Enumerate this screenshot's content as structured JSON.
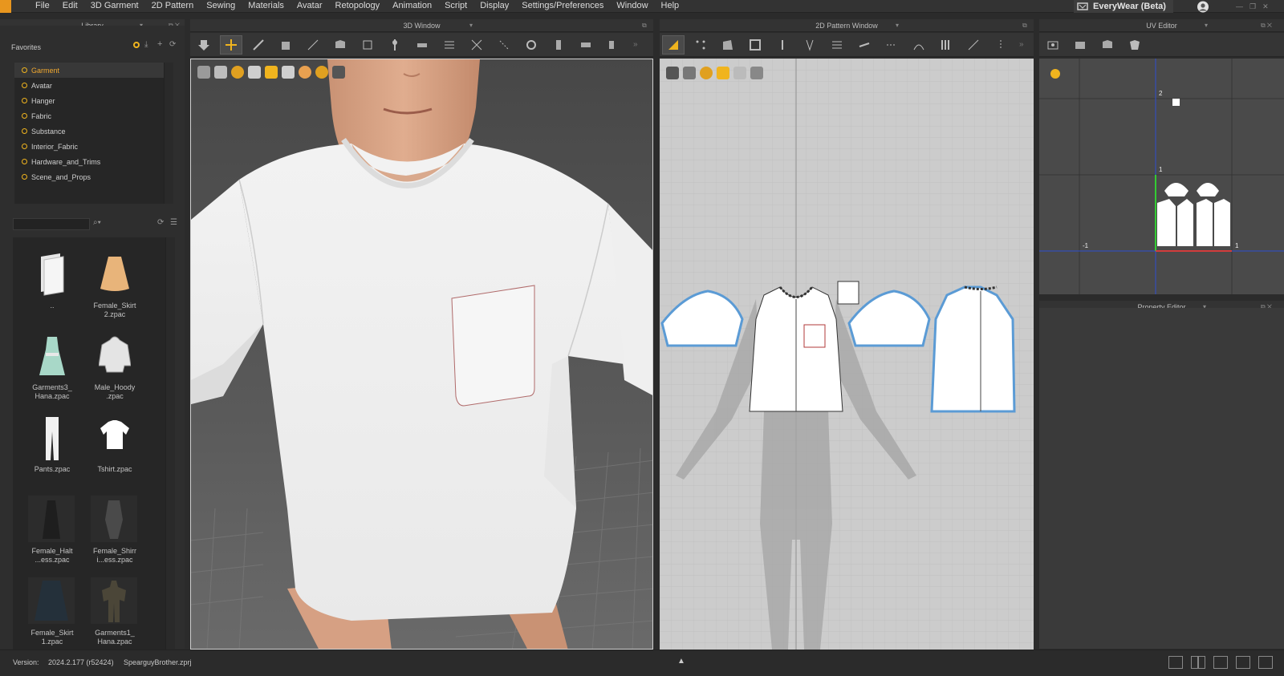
{
  "menubar": {
    "items": [
      "File",
      "Edit",
      "3D Garment",
      "2D Pattern",
      "Sewing",
      "Materials",
      "Avatar",
      "Retopology",
      "Animation",
      "Script",
      "Display",
      "Settings/Preferences",
      "Window",
      "Help"
    ],
    "brand_label": "EveryWear (Beta)"
  },
  "panels": {
    "library_title": "Library",
    "window3d_title": "3D Window",
    "window2d_title": "2D Pattern Window",
    "uv_title": "UV Editor",
    "property_title": "Property Editor"
  },
  "library": {
    "favorites_label": "Favorites",
    "folders": [
      "Garment",
      "Avatar",
      "Hanger",
      "Fabric",
      "Substance",
      "Interior_Fabric",
      "Hardware_and_Trims",
      "Scene_and_Props"
    ],
    "selected_folder": "Garment",
    "items": [
      {
        "caption": "..",
        "icon": "folder-up-icon"
      },
      {
        "caption": "Female_Skirt 2.zpac",
        "icon": "skirt-icon"
      },
      {
        "caption": "Garments3_ Hana.zpac",
        "icon": "dress-icon"
      },
      {
        "caption": "Male_Hoody .zpac",
        "icon": "hoody-icon"
      },
      {
        "caption": "Pants.zpac",
        "icon": "pants-icon"
      },
      {
        "caption": "Tshirt.zpac",
        "icon": "tshirt-icon"
      },
      {
        "caption": "Female_Halt ...ess.zpac",
        "icon": "halter-dress-icon"
      },
      {
        "caption": "Female_Shirr i...ess.zpac",
        "icon": "shirred-dress-icon"
      },
      {
        "caption": "Female_Skirt 1.zpac",
        "icon": "skirt-dark-icon"
      },
      {
        "caption": "Garments1_ Hana.zpac",
        "icon": "outfit-icon"
      }
    ]
  },
  "uv": {
    "axis_labels": [
      "2",
      "1",
      "-1",
      "1"
    ]
  },
  "status": {
    "version_label": "Version:",
    "version_value": "2024.2.177 (r52424)",
    "file_name": "SpearguyBrother.zprj"
  },
  "colors": {
    "accent": "#f0b41e",
    "pattern_outline": "#5b9bd5",
    "uv_green": "#33cc33",
    "uv_red": "#d23c3c",
    "uv_blue": "#2f4fd0"
  }
}
